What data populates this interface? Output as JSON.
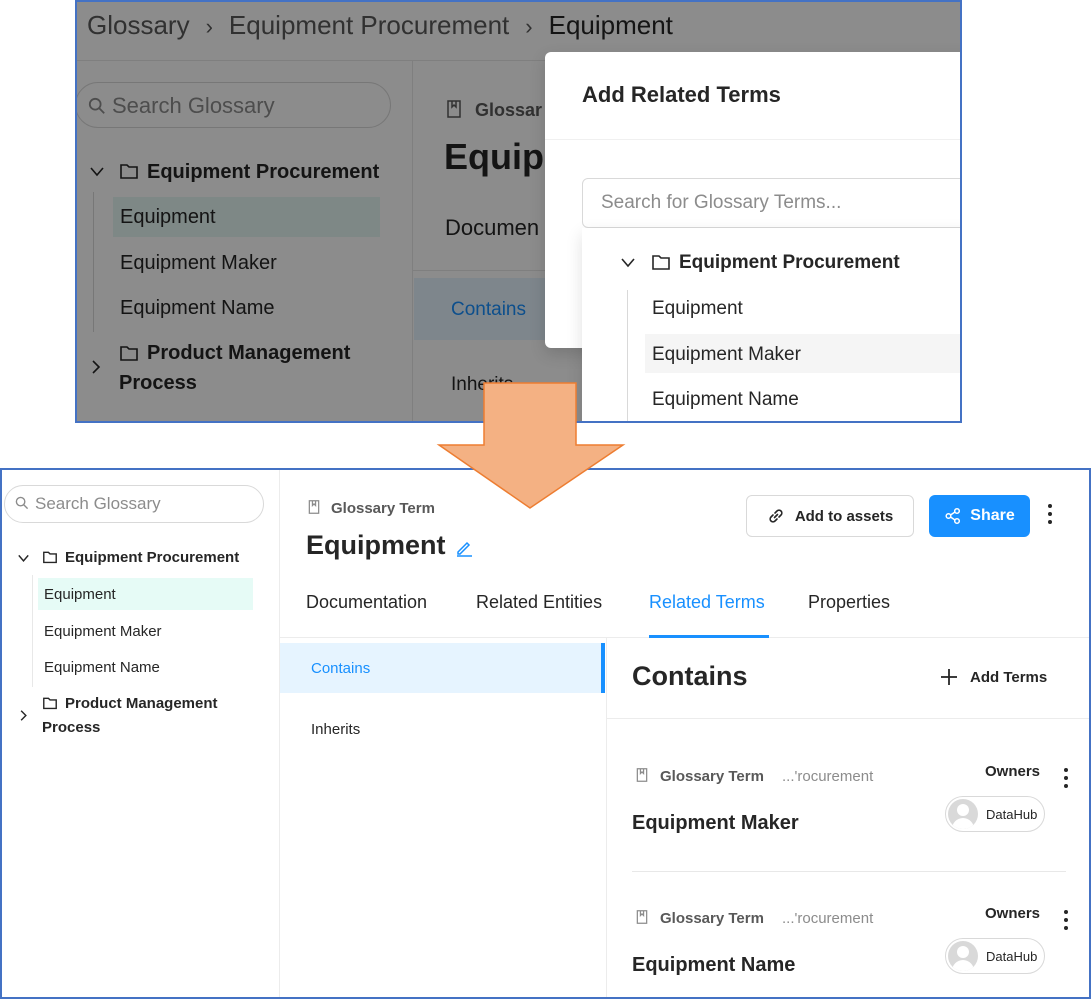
{
  "top": {
    "breadcrumb": [
      "Glossary",
      "Equipment Procurement",
      "Equipment"
    ],
    "breadcrumb_sep": "›",
    "search_placeholder": "Search Glossary",
    "tree": {
      "group1": "Equipment Procurement",
      "items": [
        "Equipment",
        "Equipment Maker",
        "Equipment Name"
      ],
      "group2_line1": "Product Management",
      "group2_line2": "Process"
    },
    "bg": {
      "type_label": "Glossar",
      "title": "Equipm",
      "tab_doc": "Documen",
      "sub_contains": "Contains",
      "sub_inherits": "Inherits"
    },
    "modal": {
      "title": "Add Related Terms",
      "search_placeholder": "Search for Glossary Terms...",
      "group": "Equipment Procurement",
      "items": [
        "Equipment",
        "Equipment Maker",
        "Equipment Name"
      ]
    }
  },
  "bottom": {
    "search_placeholder": "Search Glossary",
    "tree": {
      "group1": "Equipment Procurement",
      "items": [
        "Equipment",
        "Equipment Maker",
        "Equipment Name"
      ],
      "group2_line1": "Product Management",
      "group2_line2": "Process"
    },
    "entity_type": "Glossary Term",
    "title": "Equipment",
    "add_assets_label": "Add to assets",
    "share_label": "Share",
    "tabs": [
      "Documentation",
      "Related Entities",
      "Related Terms",
      "Properties"
    ],
    "active_tab": "Related Terms",
    "sub_nav": [
      "Contains",
      "Inherits"
    ],
    "section_title": "Contains",
    "add_terms_label": "Add Terms",
    "cards": [
      {
        "type": "Glossary Term",
        "path": "...'rocurement",
        "name": "Equipment Maker",
        "owners_label": "Owners",
        "owner": "DataHub"
      },
      {
        "type": "Glossary Term",
        "path": "...'rocurement",
        "name": "Equipment Name",
        "owners_label": "Owners",
        "owner": "DataHub"
      }
    ]
  },
  "colors": {
    "accent": "#1890ff",
    "panel_border": "#4472c4",
    "arrow_fill": "#f4b183",
    "arrow_stroke": "#ed7d31",
    "selected_tree_bg": "#e6fbf6"
  },
  "icons": [
    "search-icon",
    "chevron-down-icon",
    "chevron-right-icon",
    "folder-icon",
    "book-icon",
    "link-icon",
    "share-icon",
    "more-icon",
    "edit-icon",
    "plus-icon",
    "avatar"
  ]
}
